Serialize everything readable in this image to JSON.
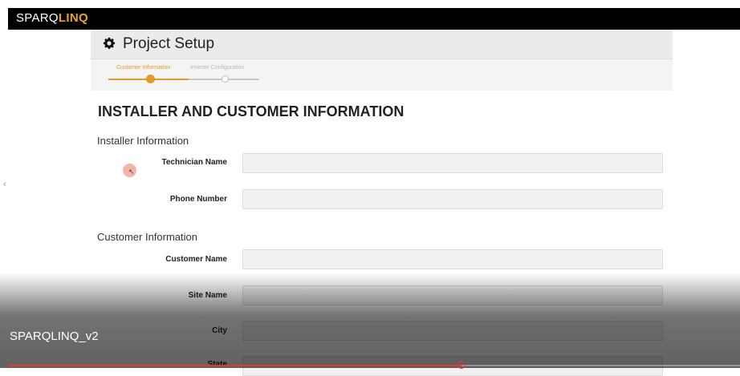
{
  "brand": {
    "name_part1": "SPARQ",
    "name_part2": "LINQ",
    "accent": "#e8a22d"
  },
  "page": {
    "title": "Project Setup",
    "icon": "gear-icon"
  },
  "steps": [
    {
      "label": "Customer Information",
      "state": "active"
    },
    {
      "label": "Inverter Configuration",
      "state": "pending"
    }
  ],
  "form": {
    "section_title": "INSTALLER AND CUSTOMER INFORMATION",
    "installer_group": "Installer Information",
    "technician_name": {
      "label": "Technician Name",
      "value": ""
    },
    "phone_number": {
      "label": "Phone Number",
      "value": ""
    },
    "customer_group": "Customer Information",
    "customer_name": {
      "label": "Customer Name",
      "value": ""
    },
    "site_name": {
      "label": "Site Name",
      "value": ""
    },
    "city": {
      "label": "City",
      "value": ""
    },
    "state": {
      "label": "State",
      "value": ""
    }
  },
  "video": {
    "title": "SPARQLINQ_v2",
    "progress": 0.62
  }
}
